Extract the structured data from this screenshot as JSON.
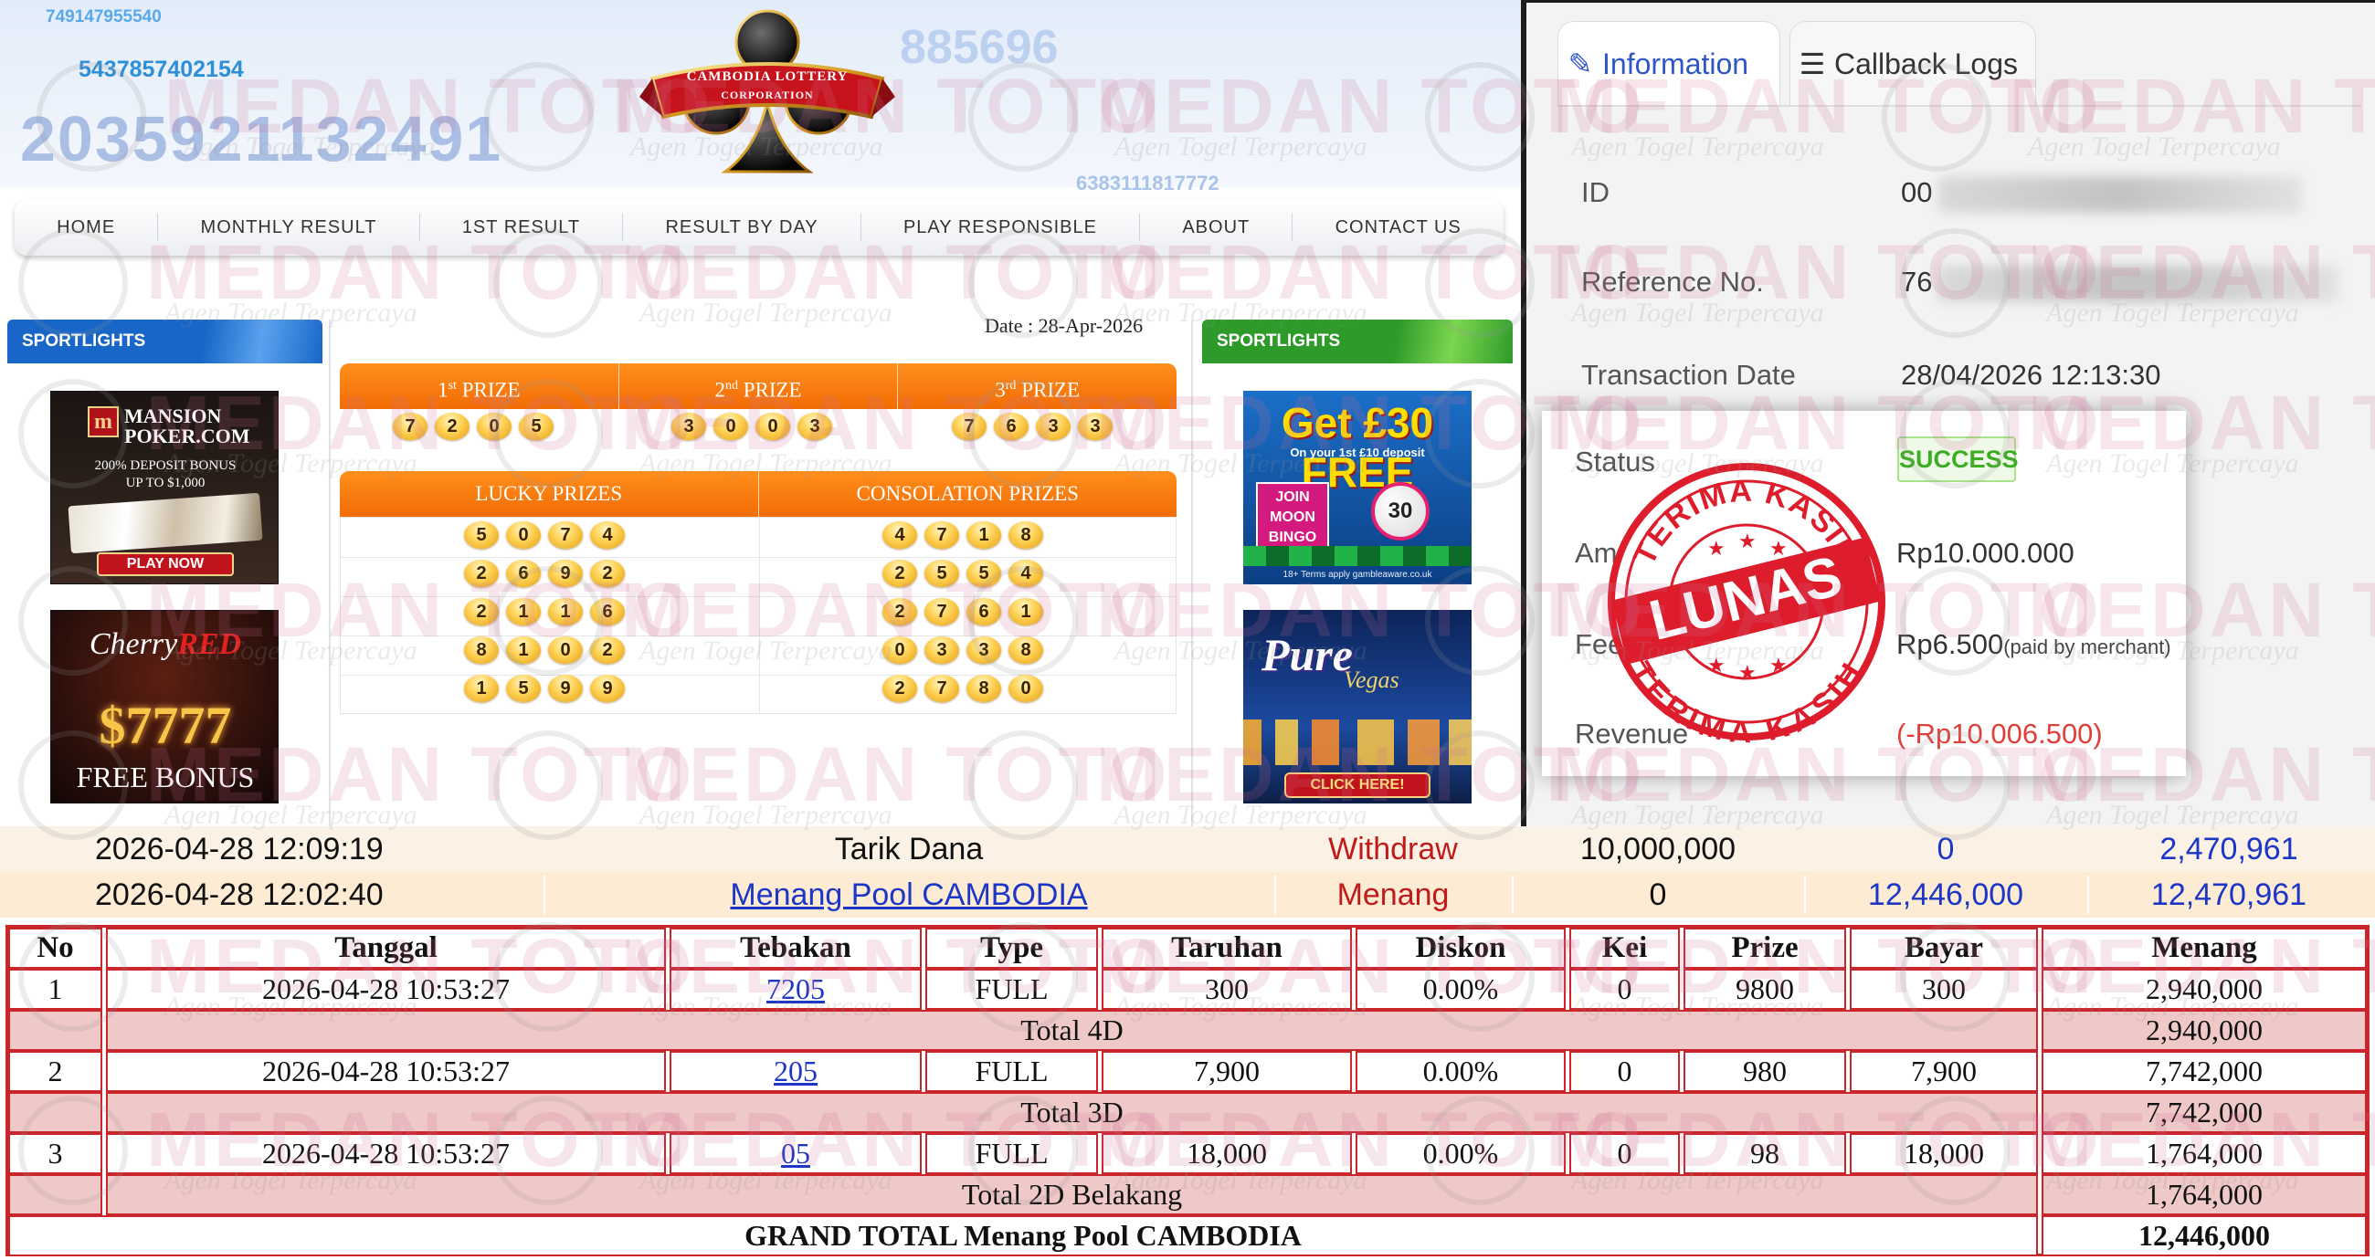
{
  "header": {
    "numbers": [
      "749147955540",
      "5437857402154",
      "2035921132491",
      "885696",
      "6383111817772"
    ],
    "logo_lines": [
      "CAMBODIA LOTTERY",
      "CORPORATION"
    ]
  },
  "nav": {
    "items": [
      "HOME",
      "MONTHLY RESULT",
      "1ST RESULT",
      "RESULT BY DAY",
      "PLAY RESPONSIBLE",
      "ABOUT",
      "CONTACT US"
    ]
  },
  "sidebar": {
    "left_title": "SPORTLIGHTS",
    "right_title": "SPORTLIGHTS"
  },
  "ads": {
    "mansion": {
      "logo": "m",
      "name": "MANSION POKER.COM",
      "bonus_1": "200% DEPOSIT BONUS",
      "bonus_2": "UP TO $1,000",
      "cta": "PLAY NOW"
    },
    "cherry": {
      "brand_1": "Cherry",
      "brand_2": "RED",
      "amount": "$7777",
      "cta": "FREE BONUS"
    },
    "bingo": {
      "headline": "Get £30 FREE",
      "sub": "On your 1st £10 deposit",
      "join": "JOIN MOON BINGO",
      "ball": "30",
      "note": "18+ Terms apply gambleaware.co.uk"
    },
    "vegas": {
      "brand_1": "Pure",
      "brand_2": "Vegas",
      "cta": "CLICK HERE!"
    }
  },
  "results": {
    "date_label": "Date : 28-Apr-2026",
    "prizes": [
      {
        "rank": "1",
        "suffix": "st",
        "label": "PRIZE",
        "digits": [
          "7",
          "2",
          "0",
          "5"
        ]
      },
      {
        "rank": "2",
        "suffix": "nd",
        "label": "PRIZE",
        "digits": [
          "3",
          "0",
          "0",
          "3"
        ]
      },
      {
        "rank": "3",
        "suffix": "rd",
        "label": "PRIZE",
        "digits": [
          "7",
          "6",
          "3",
          "3"
        ]
      }
    ],
    "lucky_title": "LUCKY PRIZES",
    "consolation_title": "CONSOLATION PRIZES",
    "lucky": [
      [
        "5",
        "0",
        "7",
        "4"
      ],
      [
        "2",
        "6",
        "9",
        "2"
      ],
      [
        "2",
        "1",
        "1",
        "6"
      ],
      [
        "8",
        "1",
        "0",
        "2"
      ],
      [
        "1",
        "5",
        "9",
        "9"
      ]
    ],
    "consolation": [
      [
        "4",
        "7",
        "1",
        "8"
      ],
      [
        "2",
        "5",
        "5",
        "4"
      ],
      [
        "2",
        "7",
        "6",
        "1"
      ],
      [
        "0",
        "3",
        "3",
        "8"
      ],
      [
        "2",
        "7",
        "8",
        "0"
      ]
    ]
  },
  "panel": {
    "tabs": [
      {
        "label": "Information",
        "icon": "pencil-icon"
      },
      {
        "label": "Callback Logs",
        "icon": "list-icon"
      }
    ],
    "id_label": "ID",
    "id_value": "00",
    "ref_label": "Reference No.",
    "ref_value": "76",
    "date_label": "Transaction Date",
    "date_value": "28/04/2026 12:13:30",
    "status_label": "Status",
    "status_value": "SUCCESS",
    "amount_label": "Amount",
    "amount_value": "Rp10.000.000",
    "fee_label": "Fee",
    "fee_value": "Rp6.500",
    "fee_note": "(paid by merchant)",
    "revenue_label": "Revenue",
    "revenue_value": "(-Rp10.006.500)"
  },
  "stamp": {
    "top": "TERIMA KASIH",
    "center": "LUNAS",
    "bottom": "TERIMA KASIH",
    "color": "#dd1d2c"
  },
  "transactions": [
    {
      "datetime": "2026-04-28 12:09:19",
      "desc": "Tarik Dana",
      "type": "Withdraw",
      "debit": "10,000,000",
      "credit": "0",
      "balance": "2,470,961"
    },
    {
      "datetime": "2026-04-28 12:02:40",
      "desc": "Menang Pool CAMBODIA",
      "type": "Menang",
      "debit": "0",
      "credit": "12,446,000",
      "balance": "12,470,961"
    }
  ],
  "bets": {
    "headers": [
      "No",
      "Tanggal",
      "Tebakan",
      "Type",
      "Taruhan",
      "Diskon",
      "Kei",
      "Prize",
      "Bayar",
      "Menang"
    ],
    "rows": [
      {
        "no": "1",
        "tanggal": "2026-04-28 10:53:27",
        "tebakan": "7205",
        "type": "FULL",
        "taruhan": "300",
        "diskon": "0.00%",
        "kei": "0",
        "prize": "9800",
        "bayar": "300",
        "menang": "2,940,000"
      },
      {
        "no": "2",
        "tanggal": "2026-04-28 10:53:27",
        "tebakan": "205",
        "type": "FULL",
        "taruhan": "7,900",
        "diskon": "0.00%",
        "kei": "0",
        "prize": "980",
        "bayar": "7,900",
        "menang": "7,742,000"
      },
      {
        "no": "3",
        "tanggal": "2026-04-28 10:53:27",
        "tebakan": "05",
        "type": "FULL",
        "taruhan": "18,000",
        "diskon": "0.00%",
        "kei": "0",
        "prize": "98",
        "bayar": "18,000",
        "menang": "1,764,000"
      }
    ],
    "totals": [
      {
        "label": "Total 4D",
        "value": "2,940,000"
      },
      {
        "label": "Total 3D",
        "value": "7,742,000"
      },
      {
        "label": "Total 2D Belakang",
        "value": "1,764,000"
      }
    ],
    "grand_label": "GRAND TOTAL  Menang Pool CAMBODIA",
    "grand_value": "12,446,000"
  },
  "watermark": {
    "main": "MEDAN TOTO",
    "sub": "Agen Togel Terpercaya",
    "seal": "Medan Toto"
  }
}
